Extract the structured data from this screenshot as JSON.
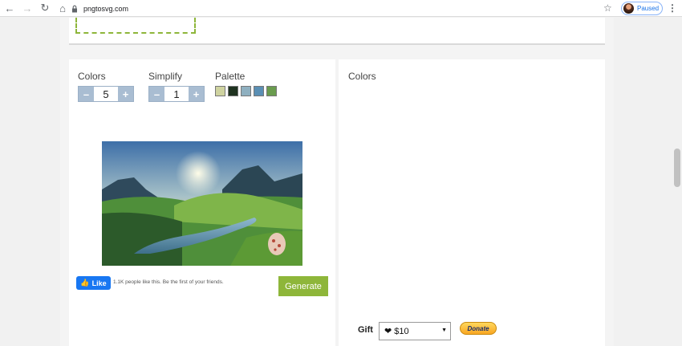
{
  "browser": {
    "url": "pngtosvg.com",
    "profile_status": "Paused"
  },
  "controls": {
    "colors_label": "Colors",
    "colors_value": "5",
    "simplify_label": "Simplify",
    "simplify_value": "1",
    "palette_label": "Palette",
    "palette": [
      "#cfd3a0",
      "#1f3320",
      "#8fb0c0",
      "#5a8fb4",
      "#6a9c4e"
    ],
    "minus": "–",
    "plus": "+"
  },
  "social": {
    "like_label": "Like",
    "like_text": "1.1K people like this. Be the first of your friends."
  },
  "generate_label": "Generate",
  "right": {
    "colors_heading": "Colors"
  },
  "gift": {
    "label": "Gift",
    "selected": "$10",
    "donate_label": "Donate"
  }
}
